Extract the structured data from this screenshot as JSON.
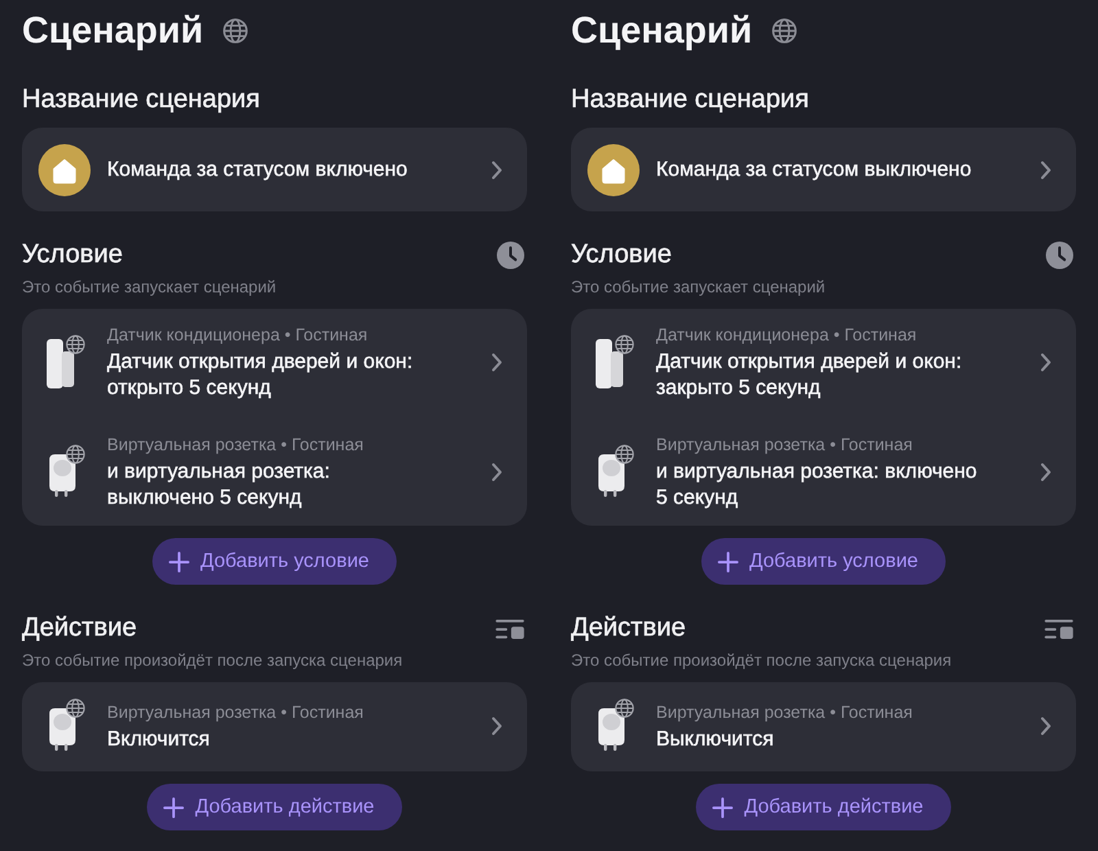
{
  "panels": [
    {
      "title": "Сценарий",
      "name_section": {
        "heading": "Название сценария",
        "command": "Команда за статусом включено"
      },
      "condition": {
        "heading": "Условие",
        "subtitle": "Это событие запускает сценарий",
        "items": [
          {
            "kind": "sensor",
            "meta": "Датчик кондиционера • Гостиная",
            "text": "Датчик открытия дверей и окон:\nоткрыто 5 секунд"
          },
          {
            "kind": "socket",
            "meta": "Виртуальная розетка • Гостиная",
            "text": "и виртуальная розетка:\nвыключено 5 секунд"
          }
        ],
        "add_button": "Добавить условие"
      },
      "action": {
        "heading": "Действие",
        "subtitle": "Это событие произойдёт после запуска сценария",
        "items": [
          {
            "kind": "socket",
            "meta": "Виртуальная розетка • Гостиная",
            "text": "Включится"
          }
        ],
        "add_button": "Добавить действие"
      }
    },
    {
      "title": "Сценарий",
      "name_section": {
        "heading": "Название сценария",
        "command": "Команда за статусом выключено"
      },
      "condition": {
        "heading": "Условие",
        "subtitle": "Это событие запускает сценарий",
        "items": [
          {
            "kind": "sensor",
            "meta": "Датчик кондиционера • Гостиная",
            "text": "Датчик открытия дверей и окон:\nзакрыто 5 секунд"
          },
          {
            "kind": "socket",
            "meta": "Виртуальная розетка • Гостиная",
            "text": "и виртуальная розетка: включено\n5 секунд"
          }
        ],
        "add_button": "Добавить условие"
      },
      "action": {
        "heading": "Действие",
        "subtitle": "Это событие произойдёт после запуска сценария",
        "items": [
          {
            "kind": "socket",
            "meta": "Виртуальная розетка • Гостиная",
            "text": "Выключится"
          }
        ],
        "add_button": "Добавить действие"
      }
    }
  ]
}
